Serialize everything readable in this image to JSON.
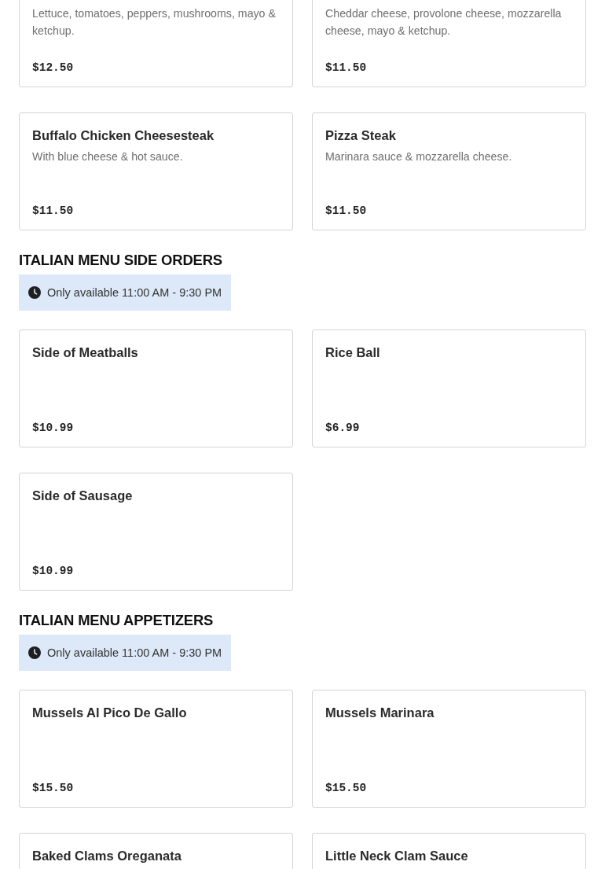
{
  "sections": [
    {
      "items": [
        {
          "description": "Lettuce, tomatoes, peppers, mushrooms, mayo & ketchup.",
          "price": "$12.50"
        },
        {
          "description": "Cheddar cheese, provolone cheese, mozzarella cheese, mayo & ketchup.",
          "price": "$11.50"
        },
        {
          "name": "Buffalo Chicken Cheesesteak",
          "description": "With blue cheese & hot sauce.",
          "price": "$11.50"
        },
        {
          "name": "Pizza Steak",
          "description": "Marinara sauce & mozzarella cheese.",
          "price": "$11.50"
        }
      ]
    },
    {
      "title": "ITALIAN MENU SIDE ORDERS",
      "availability": "Only available 11:00 AM - 9:30 PM",
      "items": [
        {
          "name": "Side of Meatballs",
          "price": "$10.99"
        },
        {
          "name": "Rice Ball",
          "price": "$6.99"
        },
        {
          "name": "Side of Sausage",
          "price": "$10.99"
        }
      ]
    },
    {
      "title": "ITALIAN MENU APPETIZERS",
      "availability": "Only available 11:00 AM - 9:30 PM",
      "items": [
        {
          "name": "Mussels Al Pico De Gallo",
          "price": "$15.50"
        },
        {
          "name": "Mussels Marinara",
          "price": "$15.50"
        },
        {
          "name": "Baked Clams Oreganata"
        },
        {
          "name": "Little Neck Clam Sauce"
        }
      ]
    }
  ]
}
